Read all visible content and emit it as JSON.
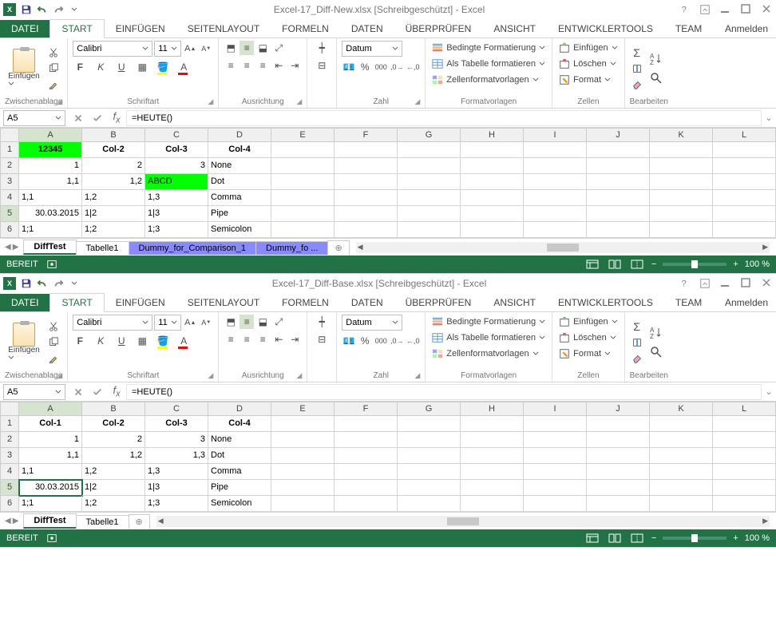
{
  "windows": [
    {
      "title": "Excel-17_Diff-New.xlsx  [Schreibgeschützt] - Excel",
      "signin": "Anmelden",
      "tabs": {
        "file": "DATEI",
        "start": "START",
        "einfuegen": "EINFÜGEN",
        "seitenlayout": "SEITENLAYOUT",
        "formeln": "FORMELN",
        "daten": "DATEN",
        "ueberpruefen": "ÜBERPRÜFEN",
        "ansicht": "ANSICHT",
        "entwickler": "ENTWICKLERTOOLS",
        "team": "TEAM"
      },
      "ribbon": {
        "clipboard_label": "Zwischenablage",
        "paste": "Einfügen",
        "font_label": "Schriftart",
        "font_name": "Calibri",
        "font_size": "11",
        "align_label": "Ausrichtung",
        "number_label": "Zahl",
        "number_format": "Datum",
        "styles_label": "Formatvorlagen",
        "cond_fmt": "Bedingte Formatierung",
        "as_table": "Als Tabelle formatieren",
        "cell_styles": "Zellenformatvorlagen",
        "cells_label": "Zellen",
        "insert": "Einfügen",
        "delete": "Löschen",
        "format": "Format",
        "editing_label": "Bearbeiten"
      },
      "namebox": "A5",
      "formula": "=HEUTE()",
      "cols": [
        "A",
        "B",
        "C",
        "D",
        "E",
        "F",
        "G",
        "H",
        "I",
        "J",
        "K",
        "L"
      ],
      "rows": [
        {
          "n": "1",
          "cells": [
            {
              "v": "12345",
              "cls": "hdr green"
            },
            {
              "v": "Col-2",
              "cls": "hdr"
            },
            {
              "v": "Col-3",
              "cls": "hdr"
            },
            {
              "v": "Col-4",
              "cls": "hdr"
            },
            {
              "v": ""
            },
            {
              "v": ""
            },
            {
              "v": ""
            },
            {
              "v": ""
            },
            {
              "v": ""
            },
            {
              "v": ""
            },
            {
              "v": ""
            },
            {
              "v": ""
            }
          ]
        },
        {
          "n": "2",
          "cells": [
            {
              "v": "1",
              "cls": "r"
            },
            {
              "v": "2",
              "cls": "r"
            },
            {
              "v": "3",
              "cls": "r"
            },
            {
              "v": "None"
            },
            {
              "v": ""
            },
            {
              "v": ""
            },
            {
              "v": ""
            },
            {
              "v": ""
            },
            {
              "v": ""
            },
            {
              "v": ""
            },
            {
              "v": ""
            },
            {
              "v": ""
            }
          ]
        },
        {
          "n": "3",
          "cells": [
            {
              "v": "1,1",
              "cls": "r"
            },
            {
              "v": "1,2",
              "cls": "r"
            },
            {
              "v": "ABCD",
              "cls": "green"
            },
            {
              "v": "Dot"
            },
            {
              "v": ""
            },
            {
              "v": ""
            },
            {
              "v": ""
            },
            {
              "v": ""
            },
            {
              "v": ""
            },
            {
              "v": ""
            },
            {
              "v": ""
            },
            {
              "v": ""
            }
          ]
        },
        {
          "n": "4",
          "cells": [
            {
              "v": "1,1"
            },
            {
              "v": "1,2"
            },
            {
              "v": "1,3"
            },
            {
              "v": "Comma"
            },
            {
              "v": ""
            },
            {
              "v": ""
            },
            {
              "v": ""
            },
            {
              "v": ""
            },
            {
              "v": ""
            },
            {
              "v": ""
            },
            {
              "v": ""
            },
            {
              "v": ""
            }
          ]
        },
        {
          "n": "5",
          "cells": [
            {
              "v": "30.03.2015",
              "cls": "r"
            },
            {
              "v": "1|2"
            },
            {
              "v": "1|3"
            },
            {
              "v": "Pipe"
            },
            {
              "v": ""
            },
            {
              "v": ""
            },
            {
              "v": ""
            },
            {
              "v": ""
            },
            {
              "v": ""
            },
            {
              "v": ""
            },
            {
              "v": ""
            },
            {
              "v": ""
            }
          ]
        },
        {
          "n": "6",
          "cells": [
            {
              "v": "1;1"
            },
            {
              "v": "1;2"
            },
            {
              "v": "1;3"
            },
            {
              "v": "Semicolon"
            },
            {
              "v": ""
            },
            {
              "v": ""
            },
            {
              "v": ""
            },
            {
              "v": ""
            },
            {
              "v": ""
            },
            {
              "v": ""
            },
            {
              "v": ""
            },
            {
              "v": ""
            }
          ]
        }
      ],
      "active_col": "A",
      "active_row": "5",
      "sheets": [
        {
          "name": "DiffTest",
          "active": true
        },
        {
          "name": "Tabelle1"
        },
        {
          "name": "Dummy_for_Comparison_1",
          "hl": true
        },
        {
          "name": "Dummy_fo",
          "hl": true,
          "trunc": "..."
        }
      ],
      "status": "BEREIT",
      "zoom": "100 %"
    },
    {
      "title": "Excel-17_Diff-Base.xlsx  [Schreibgeschützt] - Excel",
      "signin": "Anmelden",
      "tabs": {
        "file": "DATEI",
        "start": "START",
        "einfuegen": "EINFÜGEN",
        "seitenlayout": "SEITENLAYOUT",
        "formeln": "FORMELN",
        "daten": "DATEN",
        "ueberpruefen": "ÜBERPRÜFEN",
        "ansicht": "ANSICHT",
        "entwickler": "ENTWICKLERTOOLS",
        "team": "TEAM"
      },
      "ribbon": {
        "clipboard_label": "Zwischenablage",
        "paste": "Einfügen",
        "font_label": "Schriftart",
        "font_name": "Calibri",
        "font_size": "11",
        "align_label": "Ausrichtung",
        "number_label": "Zahl",
        "number_format": "Datum",
        "styles_label": "Formatvorlagen",
        "cond_fmt": "Bedingte Formatierung",
        "as_table": "Als Tabelle formatieren",
        "cell_styles": "Zellenformatvorlagen",
        "cells_label": "Zellen",
        "insert": "Einfügen",
        "delete": "Löschen",
        "format": "Format",
        "editing_label": "Bearbeiten"
      },
      "namebox": "A5",
      "formula": "=HEUTE()",
      "cols": [
        "A",
        "B",
        "C",
        "D",
        "E",
        "F",
        "G",
        "H",
        "I",
        "J",
        "K",
        "L"
      ],
      "rows": [
        {
          "n": "1",
          "cells": [
            {
              "v": "Col-1",
              "cls": "hdr"
            },
            {
              "v": "Col-2",
              "cls": "hdr"
            },
            {
              "v": "Col-3",
              "cls": "hdr"
            },
            {
              "v": "Col-4",
              "cls": "hdr"
            },
            {
              "v": ""
            },
            {
              "v": ""
            },
            {
              "v": ""
            },
            {
              "v": ""
            },
            {
              "v": ""
            },
            {
              "v": ""
            },
            {
              "v": ""
            },
            {
              "v": ""
            }
          ]
        },
        {
          "n": "2",
          "cells": [
            {
              "v": "1",
              "cls": "r"
            },
            {
              "v": "2",
              "cls": "r"
            },
            {
              "v": "3",
              "cls": "r"
            },
            {
              "v": "None"
            },
            {
              "v": ""
            },
            {
              "v": ""
            },
            {
              "v": ""
            },
            {
              "v": ""
            },
            {
              "v": ""
            },
            {
              "v": ""
            },
            {
              "v": ""
            },
            {
              "v": ""
            }
          ]
        },
        {
          "n": "3",
          "cells": [
            {
              "v": "1,1",
              "cls": "r"
            },
            {
              "v": "1,2",
              "cls": "r"
            },
            {
              "v": "1,3",
              "cls": "r"
            },
            {
              "v": "Dot"
            },
            {
              "v": ""
            },
            {
              "v": ""
            },
            {
              "v": ""
            },
            {
              "v": ""
            },
            {
              "v": ""
            },
            {
              "v": ""
            },
            {
              "v": ""
            },
            {
              "v": ""
            }
          ]
        },
        {
          "n": "4",
          "cells": [
            {
              "v": "1,1"
            },
            {
              "v": "1,2"
            },
            {
              "v": "1,3"
            },
            {
              "v": "Comma"
            },
            {
              "v": ""
            },
            {
              "v": ""
            },
            {
              "v": ""
            },
            {
              "v": ""
            },
            {
              "v": ""
            },
            {
              "v": ""
            },
            {
              "v": ""
            },
            {
              "v": ""
            }
          ]
        },
        {
          "n": "5",
          "cells": [
            {
              "v": "30.03.2015",
              "cls": "r sel"
            },
            {
              "v": "1|2"
            },
            {
              "v": "1|3"
            },
            {
              "v": "Pipe"
            },
            {
              "v": ""
            },
            {
              "v": ""
            },
            {
              "v": ""
            },
            {
              "v": ""
            },
            {
              "v": ""
            },
            {
              "v": ""
            },
            {
              "v": ""
            },
            {
              "v": ""
            }
          ]
        },
        {
          "n": "6",
          "cells": [
            {
              "v": "1;1"
            },
            {
              "v": "1;2"
            },
            {
              "v": "1;3"
            },
            {
              "v": "Semicolon"
            },
            {
              "v": ""
            },
            {
              "v": ""
            },
            {
              "v": ""
            },
            {
              "v": ""
            },
            {
              "v": ""
            },
            {
              "v": ""
            },
            {
              "v": ""
            },
            {
              "v": ""
            }
          ]
        }
      ],
      "active_col": "A",
      "active_row": "5",
      "sheets": [
        {
          "name": "DiffTest",
          "active": true
        },
        {
          "name": "Tabelle1"
        }
      ],
      "status": "BEREIT",
      "zoom": "100 %"
    }
  ]
}
